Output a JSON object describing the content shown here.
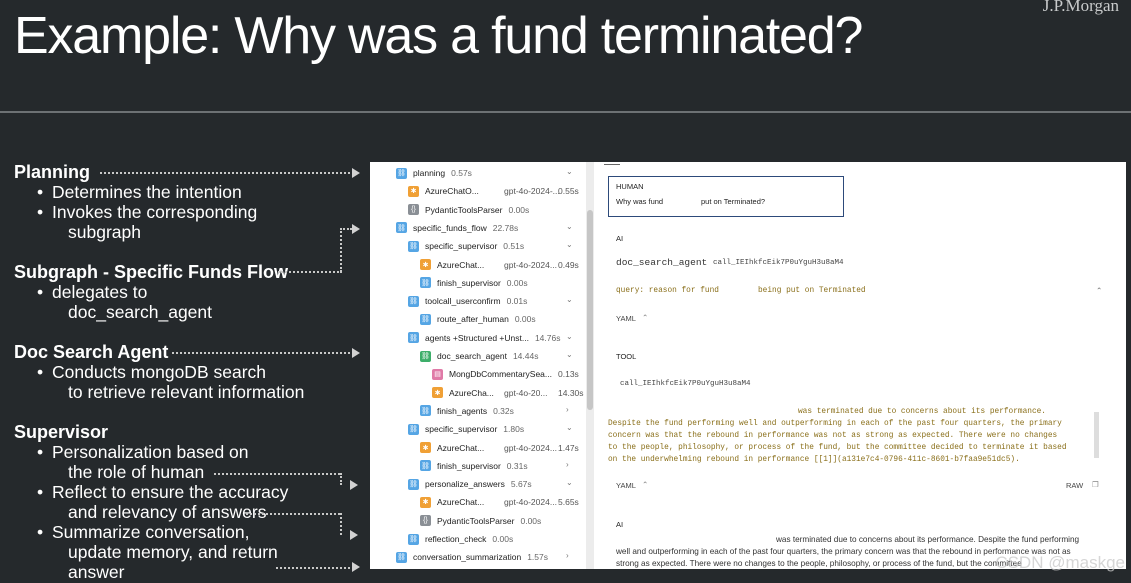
{
  "slide": {
    "title": "Example: Why was a fund terminated?",
    "brand": "J.P.Morgan"
  },
  "left": {
    "planning": {
      "title": "Planning",
      "bullets": [
        "Determines the intention",
        "Invokes the corresponding",
        "subgraph"
      ]
    },
    "subgraph": {
      "title": "Subgraph - Specific Funds Flow",
      "bullets": [
        "delegates to",
        "doc_search_agent"
      ]
    },
    "docsearch": {
      "title": "Doc Search Agent",
      "bullets": [
        "Conducts mongoDB search",
        "to retrieve relevant information"
      ]
    },
    "supervisor": {
      "title": "Supervisor",
      "bullets": [
        "Personalization based on",
        "the role of human",
        "Reflect to ensure the accuracy",
        "and relevancy of answers",
        "Summarize conversation,",
        "update memory, and return",
        "answer"
      ]
    }
  },
  "tree": [
    {
      "label": "planning",
      "time": "0.57s",
      "icon": "link-icon",
      "model": "",
      "rtime": ""
    },
    {
      "label": "AzureChatO...",
      "time": "",
      "icon": "openai-icon",
      "model": "gpt-4o-2024-...",
      "rtime": "0.55s"
    },
    {
      "label": "PydanticToolsParser",
      "time": "0.00s",
      "icon": "parser-icon",
      "model": "",
      "rtime": ""
    },
    {
      "label": "specific_funds_flow",
      "time": "22.78s",
      "icon": "link-icon",
      "model": "",
      "rtime": ""
    },
    {
      "label": "specific_supervisor",
      "time": "0.51s",
      "icon": "link-icon",
      "model": "",
      "rtime": ""
    },
    {
      "label": "AzureChat...",
      "time": "",
      "icon": "openai-icon",
      "model": "gpt-4o-2024...",
      "rtime": "0.49s"
    },
    {
      "label": "finish_supervisor",
      "time": "0.00s",
      "icon": "link-icon",
      "model": "",
      "rtime": ""
    },
    {
      "label": "toolcall_userconfirm",
      "time": "0.01s",
      "icon": "link-icon",
      "model": "",
      "rtime": ""
    },
    {
      "label": "route_after_human",
      "time": "0.00s",
      "icon": "link-icon",
      "model": "",
      "rtime": ""
    },
    {
      "label": "agents +Structured +Unst...",
      "time": "14.76s",
      "icon": "link-icon",
      "model": "",
      "rtime": ""
    },
    {
      "label": "doc_search_agent",
      "time": "14.44s",
      "icon": "agent-icon",
      "model": "",
      "rtime": ""
    },
    {
      "label": "MongDbCommentarySea...",
      "time": "",
      "icon": "retriever-icon",
      "model": "",
      "rtime": "0.13s"
    },
    {
      "label": "AzureCha...",
      "time": "",
      "icon": "openai-icon",
      "model": "gpt-4o-20...",
      "rtime": "14.30s"
    },
    {
      "label": "finish_agents",
      "time": "0.32s",
      "icon": "link-icon",
      "model": "",
      "rtime": ""
    },
    {
      "label": "specific_supervisor",
      "time": "1.80s",
      "icon": "link-icon",
      "model": "",
      "rtime": ""
    },
    {
      "label": "AzureChat...",
      "time": "",
      "icon": "openai-icon",
      "model": "gpt-4o-2024...",
      "rtime": "1.47s"
    },
    {
      "label": "finish_supervisor",
      "time": "0.31s",
      "icon": "link-icon",
      "model": "",
      "rtime": ""
    },
    {
      "label": "personalize_answers",
      "time": "5.67s",
      "icon": "link-icon",
      "model": "",
      "rtime": ""
    },
    {
      "label": "AzureChat...",
      "time": "",
      "icon": "openai-icon",
      "model": "gpt-4o-2024...",
      "rtime": "5.65s"
    },
    {
      "label": "PydanticToolsParser",
      "time": "0.00s",
      "icon": "parser-icon",
      "model": "",
      "rtime": ""
    },
    {
      "label": "reflection_check",
      "time": "0.00s",
      "icon": "link-icon",
      "model": "",
      "rtime": ""
    },
    {
      "label": "conversation_summarization",
      "time": "1.57s",
      "icon": "link-icon",
      "model": "",
      "rtime": ""
    }
  ],
  "detail": {
    "human": {
      "role": "HUMAN",
      "text_a": "Why was fund",
      "text_b": "put on Terminated?"
    },
    "ai": {
      "role": "AI",
      "tool_name": "doc_search_agent",
      "call_id": "call_IEIhkfcEik7P0uYguH3u8aM4",
      "query": "query: reason for fund",
      "query_b": "being put on Terminated",
      "format": "YAML"
    },
    "tool": {
      "role": "TOOL",
      "call_id": "call_IEIhkfcEik7P0uYguH3u8aM4",
      "lines": [
        "was terminated due to concerns about its performance.",
        "Despite the fund performing well and outperforming in each of the past four quarters, the primary",
        "concern was that the rebound in performance was not as strong as expected. There were no changes",
        "to the people, philosophy, or process of the fund, but the committee decided to terminate it based",
        "on the underwhelming rebound in performance [[1]](a131e7c4-0796-411c-8601-b7faa9e51dc5)."
      ],
      "format": "YAML",
      "raw": "RAW"
    },
    "ai2": {
      "role": "AI",
      "lines": [
        "was terminated due to concerns about its performance. Despite the fund performing",
        "well and outperforming in each of the past four quarters, the primary concern was that the rebound in performance was not as",
        "strong as expected. There were no changes to the people, philosophy, or process of the fund, but the committee"
      ]
    }
  },
  "watermark": "CSDN @maskge"
}
